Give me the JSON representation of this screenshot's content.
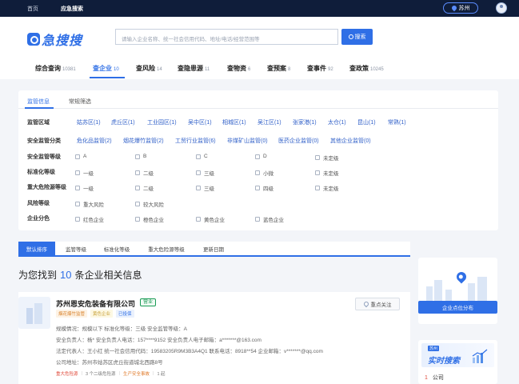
{
  "topbar": {
    "nav": [
      "首页",
      "应急搜索"
    ],
    "city": "苏州"
  },
  "logo": {
    "text": "急搜搜"
  },
  "search": {
    "placeholder": "请输入企业名称、统一社会信用代码、地址/电话/经营范围等",
    "button": "搜索"
  },
  "tabs": [
    {
      "label": "综合查询",
      "count": "10381"
    },
    {
      "label": "查企业",
      "count": "10"
    },
    {
      "label": "查风险",
      "count": "14"
    },
    {
      "label": "查隐患源",
      "count": "11"
    },
    {
      "label": "查物资",
      "count": "6"
    },
    {
      "label": "查预案",
      "count": "8"
    },
    {
      "label": "查事件",
      "count": "92"
    },
    {
      "label": "查政策",
      "count": "10245"
    }
  ],
  "filter": {
    "tabs": [
      "监管信息",
      "常规筛选"
    ],
    "rows": [
      {
        "label": "监管区域",
        "options": [
          "姑苏区(1)",
          "虎丘区(1)",
          "工业园区(1)",
          "吴中区(1)",
          "相城区(1)",
          "吴江区(1)",
          "张家港(1)",
          "太仓(1)",
          "昆山(1)",
          "常熟(1)"
        ]
      },
      {
        "label": "安全监管分类",
        "options": [
          "危化品监管(2)",
          "烟花爆竹监管(2)",
          "工贸行业监管(6)",
          "非煤矿山监管(0)",
          "医药企业监管(0)",
          "其他企业监管(0)"
        ]
      },
      {
        "label": "安全监管等级",
        "options": [
          "A",
          "B",
          "C",
          "D",
          "未定级"
        ]
      },
      {
        "label": "标准化等级",
        "options": [
          "一级",
          "二级",
          "三级",
          "小微",
          "未定级"
        ]
      },
      {
        "label": "重大危险源等级",
        "options": [
          "一级",
          "二级",
          "三级",
          "四级",
          "未定级"
        ]
      },
      {
        "label": "风险等级",
        "options": [
          "重大风险",
          "较大风险"
        ]
      },
      {
        "label": "企业分色",
        "options": [
          "红色企业",
          "橙色企业",
          "黄色企业",
          "蓝色企业"
        ]
      }
    ]
  },
  "sort": [
    "默认排序",
    "监管等级",
    "标准化等级",
    "重大危险源等级",
    "更新日期"
  ],
  "results": {
    "prefix": "为您找到",
    "count": "10",
    "suffix": "条企业相关信息"
  },
  "company": {
    "name": "苏州恩安危装备有限公司",
    "status": "营业",
    "tags": [
      "烟花爆竹监管",
      "黄色企业",
      "已投保"
    ],
    "follow": "重点关注",
    "line1": "规模情况：规模以下    标准化等级：三级    安全监管等级：A",
    "line2": "安全负责人：杨*    安全负责人电话：157****9152    安全负责人电子邮箱：a*******@163.com",
    "line3": "法定代表人：王小红    统一社会信用代码：19583205R9M3B3A4Q1    联系电话：8918**54    企业邮箱：v*******@qq.com",
    "line4": "公司地址：苏州市姑苏区虎丘街道城北西路8号",
    "risk": [
      "重大危险源",
      "3 个二级危险源",
      "生产安全事故",
      "1 起"
    ]
  },
  "side": {
    "map_button": "企业点位分布",
    "hot_tag": "苏州",
    "hot_title": "实时搜索",
    "hot_rank": "1",
    "hot_item": "公司"
  }
}
